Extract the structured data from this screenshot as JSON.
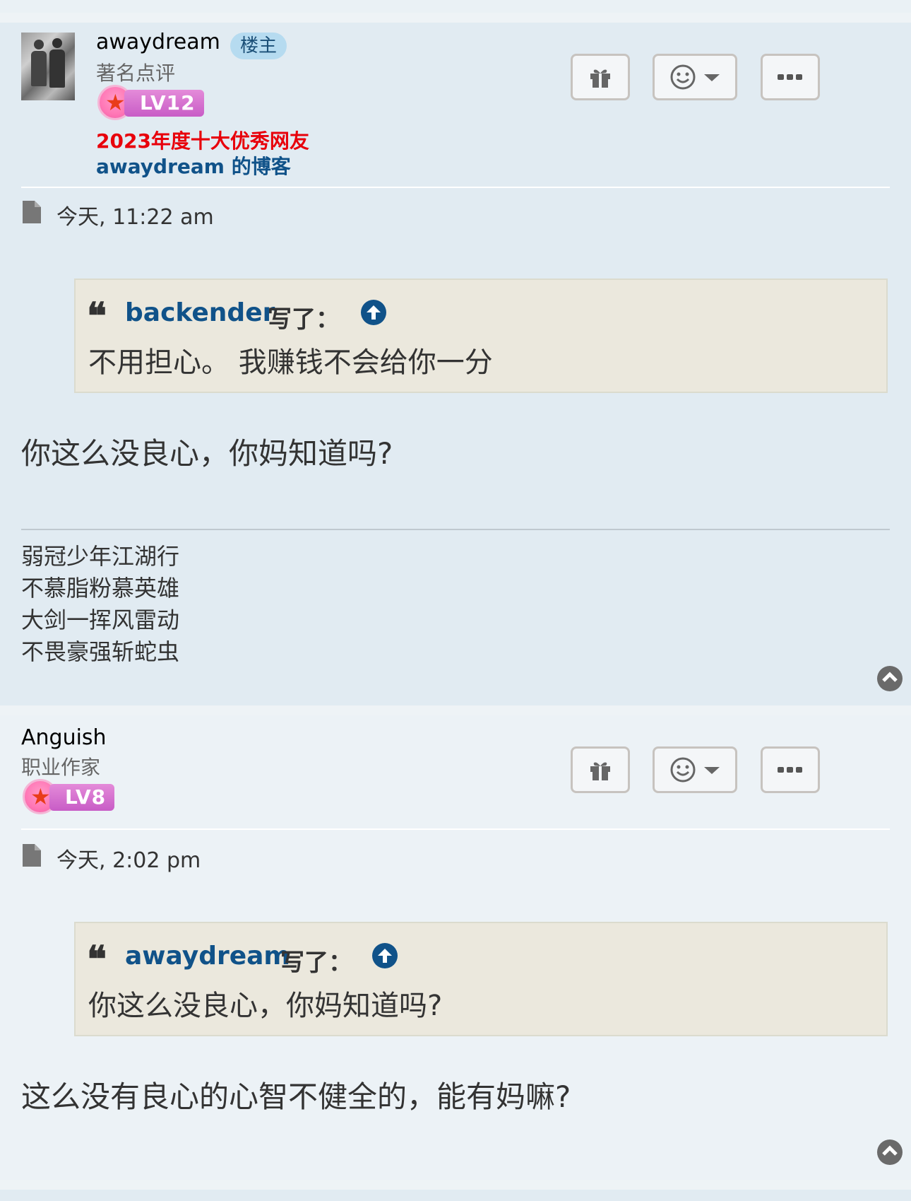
{
  "posts": [
    {
      "username": "awaydream",
      "owner_badge": "楼主",
      "rank": "著名点评",
      "level": "LV12",
      "award": "2023年度十大优秀网友",
      "blog_link": "awaydream 的博客",
      "time": "今天, 11:22 am",
      "quote": {
        "author": "backender",
        "wrote": "写了：",
        "text": "不用担心。 我赚钱不会给你一分"
      },
      "content": "你这么没良心，你妈知道吗?",
      "signature": [
        "弱冠少年江湖行",
        "不慕脂粉慕英雄",
        "大剑一挥风雷动",
        "不畏豪强斩蛇虫"
      ]
    },
    {
      "username": "Anguish",
      "rank": "职业作家",
      "level": "LV8",
      "time": "今天, 2:02 pm",
      "quote": {
        "author": "awaydream",
        "wrote": "写了：",
        "text": "你这么没良心，你妈知道吗?"
      },
      "content": "这么没有良心的心智不健全的，能有妈嘛?"
    }
  ],
  "icons": {
    "gift": "gift-icon",
    "reaction": "smiley-icon",
    "more": "ellipsis-icon",
    "post": "file-icon",
    "quote_up": "arrow-up-circle-icon",
    "back_to_top": "chevron-up-circle-icon"
  },
  "colors": {
    "post1_bg": "#e1ebf2",
    "post2_bg": "#ecf2f6",
    "link": "#105289",
    "award": "#e8000b",
    "quote_bg": "#ebe8dd"
  }
}
